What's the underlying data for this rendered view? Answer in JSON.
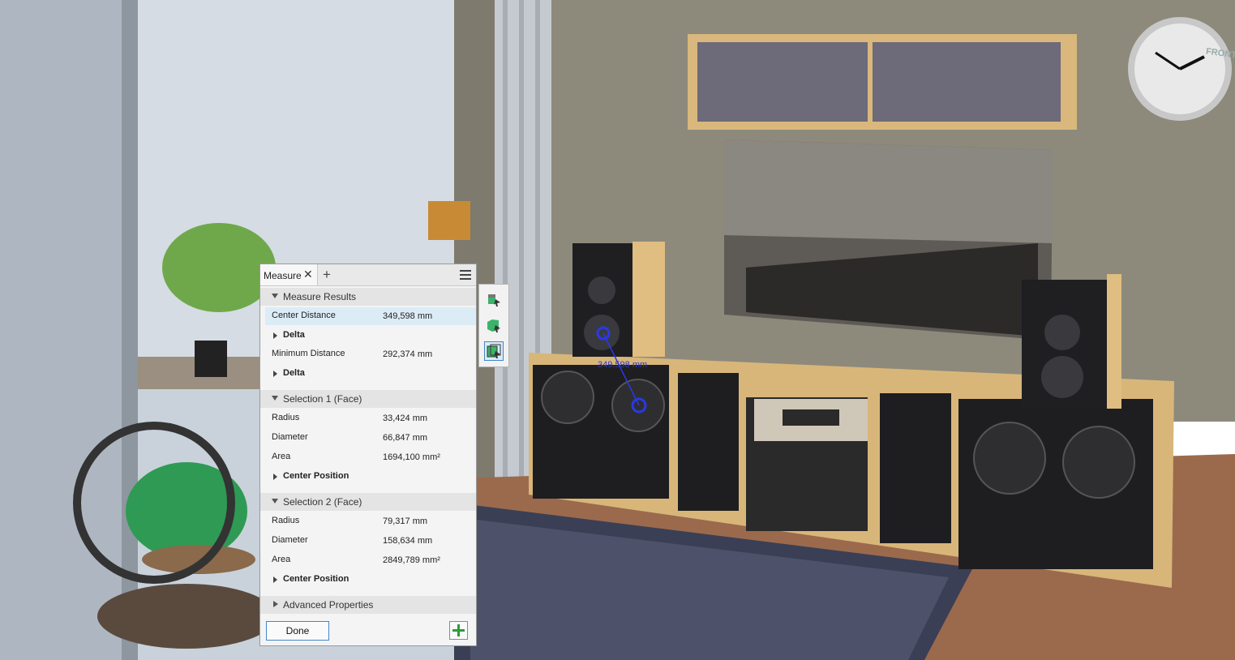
{
  "measure_panel": {
    "tab_label": "Measure",
    "sections": {
      "results": {
        "title": "Measure Results",
        "center_distance": {
          "label": "Center Distance",
          "value": "349,598 mm"
        },
        "delta1": "Delta",
        "minimum_distance": {
          "label": "Minimum Distance",
          "value": "292,374 mm"
        },
        "delta2": "Delta"
      },
      "selection1": {
        "title": "Selection 1 (Face)",
        "radius": {
          "label": "Radius",
          "value": "33,424 mm"
        },
        "diameter": {
          "label": "Diameter",
          "value": "66,847 mm"
        },
        "area": {
          "label": "Area",
          "value": "1694,100 mm²"
        },
        "center_position": "Center Position"
      },
      "selection2": {
        "title": "Selection 2 (Face)",
        "radius": {
          "label": "Radius",
          "value": "79,317 mm"
        },
        "diameter": {
          "label": "Diameter",
          "value": "158,634 mm"
        },
        "area": {
          "label": "Area",
          "value": "2849,789 mm²"
        },
        "center_position": "Center Position"
      },
      "advanced": {
        "title": "Advanced Properties"
      }
    },
    "done_label": "Done"
  },
  "viewport": {
    "dimension_label": "349,598 mm",
    "viewcube_label": "FRONT"
  },
  "colors": {
    "selection_highlight": "#dcecf7",
    "dimension": "#2a38c8",
    "add_green": "#2e9b3a"
  }
}
